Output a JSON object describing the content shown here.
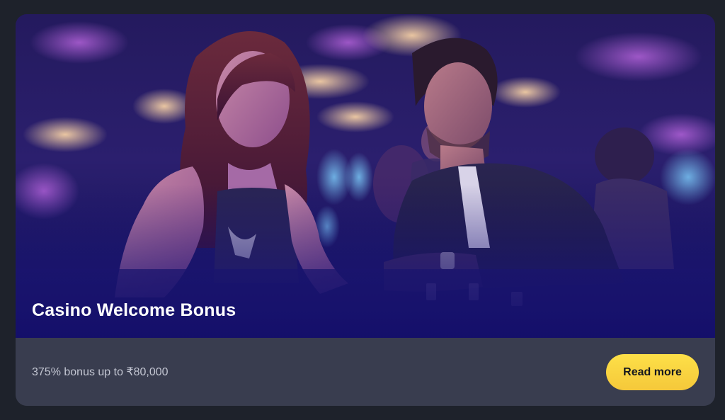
{
  "card": {
    "title": "Casino Welcome Bonus",
    "description": "375% bonus up to ₹80,000",
    "button_label": "Read more"
  },
  "colors": {
    "page_background": "#1e222b",
    "card_footer": "#393d4f",
    "title_text": "#ffffff",
    "description_text": "#c3c6d2",
    "button_background": "#fcd846",
    "button_text": "#15171e"
  },
  "hero_image": {
    "icon": "casino-couple-illustration"
  }
}
